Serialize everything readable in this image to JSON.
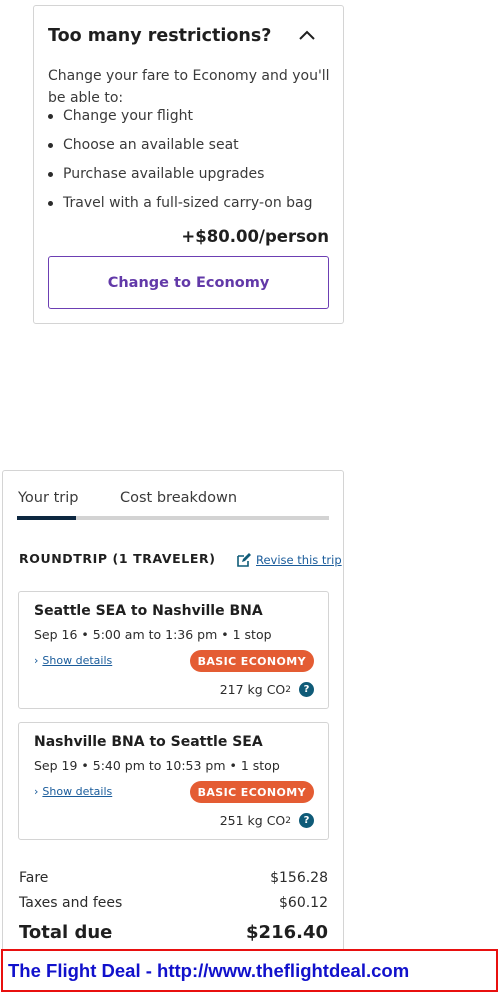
{
  "restrictions": {
    "title": "Too many restrictions?",
    "intro": "Change your fare to Economy and you'll be able to:",
    "benefits": [
      "Change your flight",
      "Choose an available seat",
      "Purchase available upgrades",
      "Travel with a full-sized carry-on bag"
    ],
    "price": "+$80.00/person",
    "button_label": "Change to Economy",
    "collapse_icon": "chevron-up-icon",
    "accent_color": "#6239a8"
  },
  "trip": {
    "tabs": [
      {
        "label": "Your trip",
        "active": true
      },
      {
        "label": "Cost breakdown",
        "active": false
      }
    ],
    "trip_type": "ROUNDTRIP (1 TRAVELER)",
    "revise_link": "Revise this trip",
    "revise_icon": "edit-icon",
    "legs": [
      {
        "route": "Seattle SEA to Nashville BNA",
        "times": "Sep 16 • 5:00 am to 1:36 pm • 1 stop",
        "details_link": "Show details",
        "fare_badge": "BASIC ECONOMY",
        "co2_value": "217 kg CO",
        "co2_sub": "2"
      },
      {
        "route": "Nashville BNA to Seattle SEA",
        "times": "Sep 19 • 5:40 pm to 10:53 pm • 1 stop",
        "details_link": "Show details",
        "fare_badge": "BASIC ECONOMY",
        "co2_value": "251 kg CO",
        "co2_sub": "2"
      }
    ],
    "badge_color": "#e45c33",
    "costs": {
      "fare_label": "Fare",
      "fare_amount": "$156.28",
      "taxes_label": "Taxes and fees",
      "taxes_amount": "$60.12",
      "total_label": "Total due",
      "total_amount": "$216.40"
    }
  },
  "banner": {
    "text": "The Flight Deal - http://www.theflightdeal.com",
    "border_color": "#e8100f",
    "text_color": "#1111cc"
  }
}
